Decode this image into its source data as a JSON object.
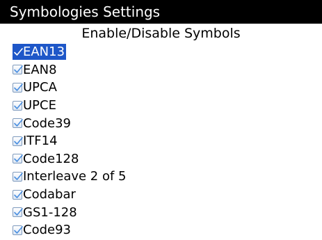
{
  "window": {
    "title": "Symbologies Settings"
  },
  "header": {
    "subtitle": "Enable/Disable Symbols"
  },
  "colors": {
    "check_color": "#4a8fe0",
    "selected_bg": "#1e57c8"
  },
  "symbols": [
    {
      "label": "EAN13",
      "checked": true,
      "selected": true
    },
    {
      "label": "EAN8",
      "checked": true,
      "selected": false
    },
    {
      "label": "UPCA",
      "checked": true,
      "selected": false
    },
    {
      "label": "UPCE",
      "checked": true,
      "selected": false
    },
    {
      "label": "Code39",
      "checked": true,
      "selected": false
    },
    {
      "label": "ITF14",
      "checked": true,
      "selected": false
    },
    {
      "label": "Code128",
      "checked": true,
      "selected": false
    },
    {
      "label": "Interleave 2 of 5",
      "checked": true,
      "selected": false
    },
    {
      "label": "Codabar",
      "checked": true,
      "selected": false
    },
    {
      "label": "GS1-128",
      "checked": true,
      "selected": false
    },
    {
      "label": "Code93",
      "checked": true,
      "selected": false
    }
  ]
}
